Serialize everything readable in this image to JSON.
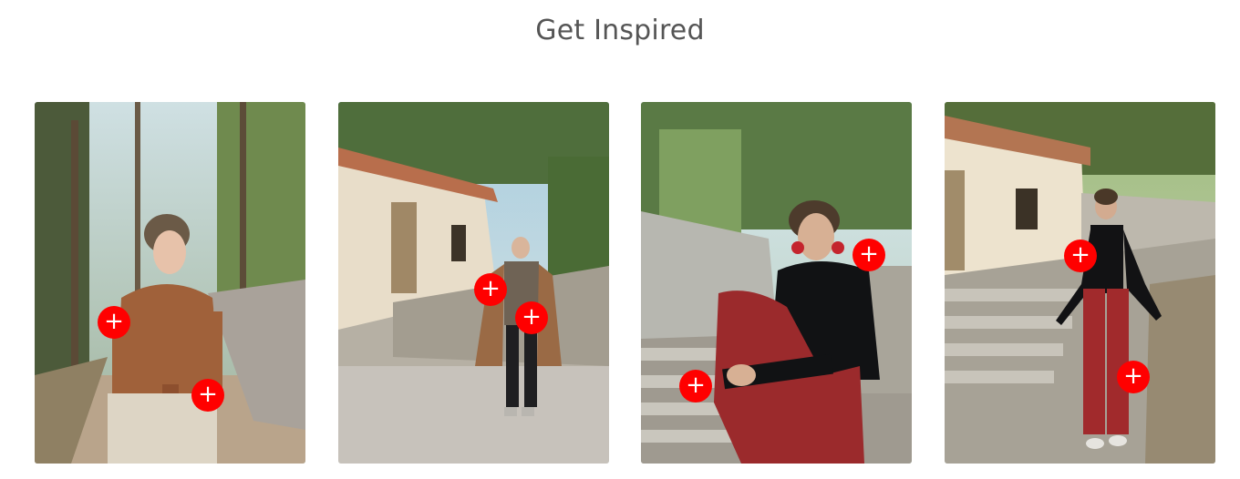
{
  "page": {
    "title": "Get Inspired"
  },
  "colors": {
    "hotspot": "#ff0000",
    "hotspot_icon": "#ffffff",
    "title": "#555555"
  },
  "gallery": [
    {
      "photo": "woman-in-brown-blouse-on-forest-path",
      "hotspots": [
        {
          "icon": "+"
        },
        {
          "icon": "+"
        }
      ]
    },
    {
      "photo": "woman-in-coat-walking-by-white-house",
      "hotspots": [
        {
          "icon": "+"
        },
        {
          "icon": "+"
        }
      ]
    },
    {
      "photo": "woman-in-black-top-seated-on-steps",
      "hotspots": [
        {
          "icon": "+"
        },
        {
          "icon": "+"
        }
      ]
    },
    {
      "photo": "woman-in-red-trousers-on-stone-steps",
      "hotspots": [
        {
          "icon": "+"
        },
        {
          "icon": "+"
        }
      ]
    }
  ]
}
